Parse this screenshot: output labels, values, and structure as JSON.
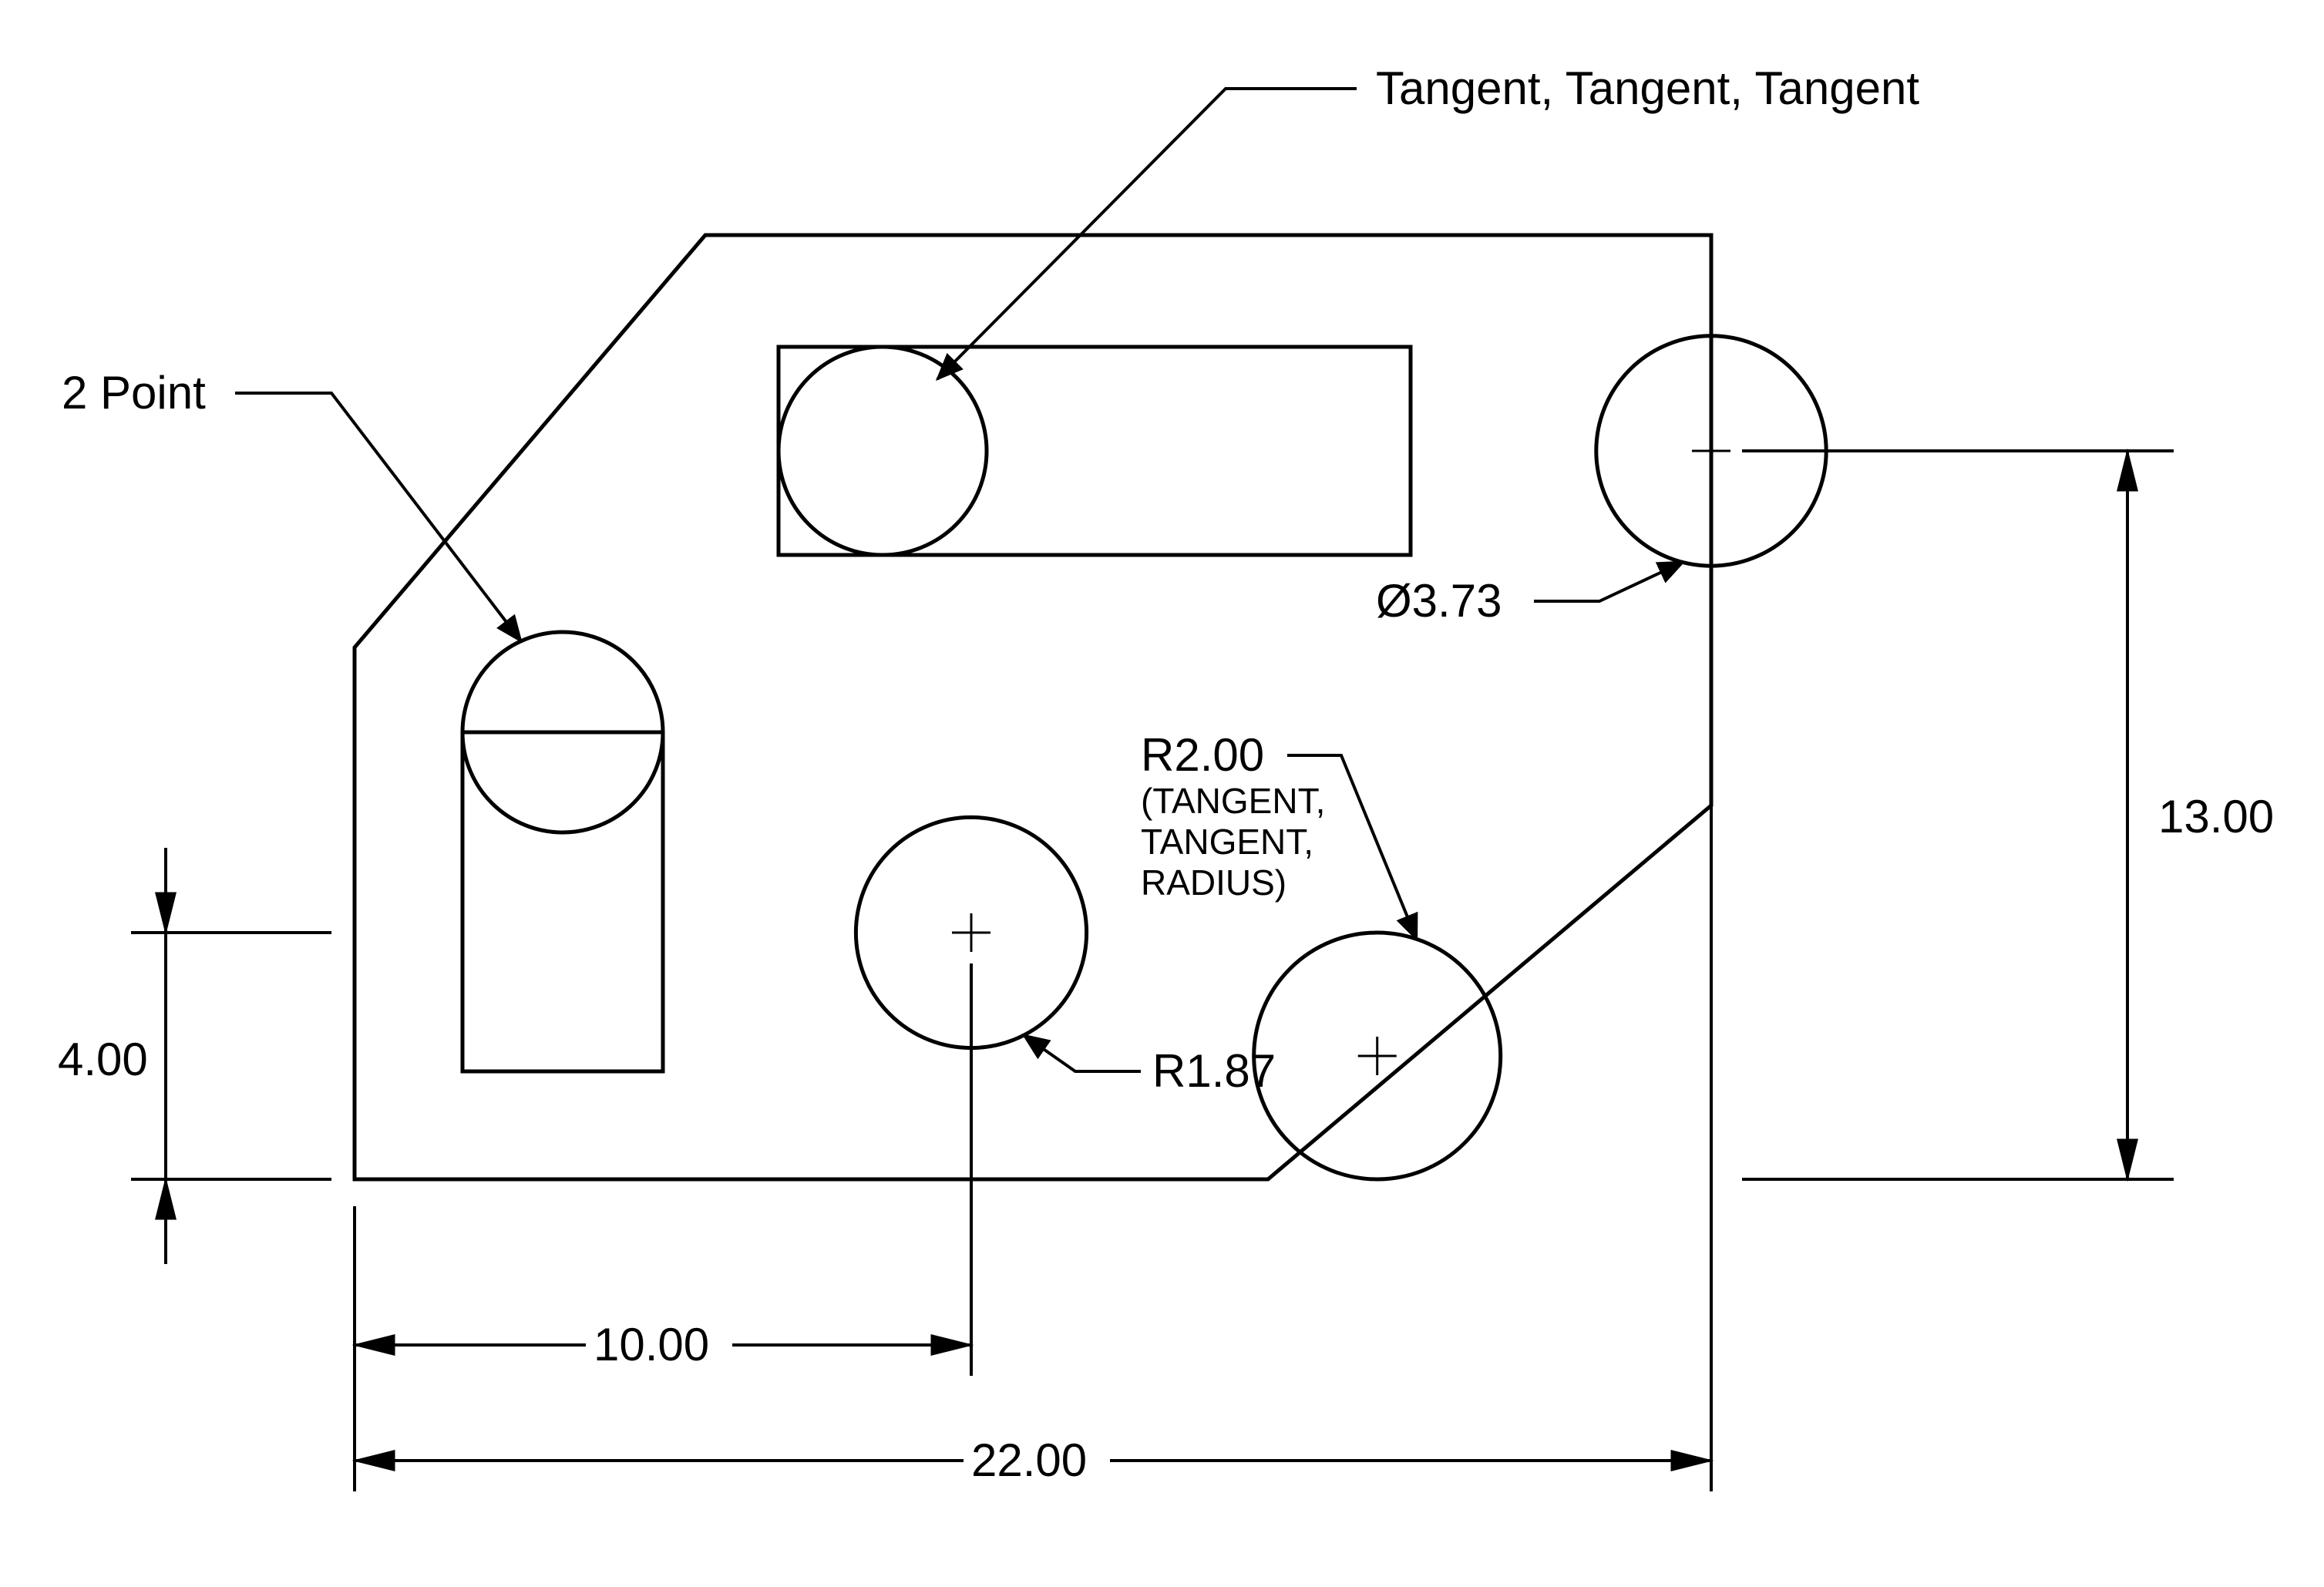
{
  "labels": {
    "tangent3": "Tangent, Tangent, Tangent",
    "two_point": "2 Point",
    "diameter": "Ø3.73",
    "radius_ttr": "R2.00",
    "radius_ttr_sub1": "(TANGENT,",
    "radius_ttr_sub2": "TANGENT,",
    "radius_ttr_sub3": "RADIUS)",
    "radius_center": "R1.87"
  },
  "dims": {
    "height_right": "13.00",
    "height_left": "4.00",
    "width_10": "10.00",
    "width_22": "22.00"
  }
}
